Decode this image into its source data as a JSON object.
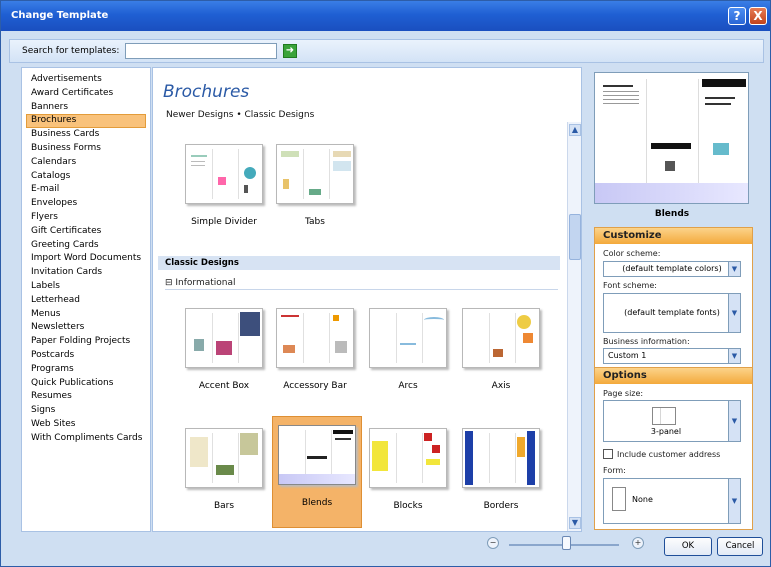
{
  "window": {
    "title": "Change Template",
    "help_label": "?",
    "close_label": "X"
  },
  "search": {
    "label": "Search for templates:",
    "value": "",
    "placeholder": ""
  },
  "categories": [
    "Advertisements",
    "Award Certificates",
    "Banners",
    "Brochures",
    "Business Cards",
    "Business Forms",
    "Calendars",
    "Catalogs",
    "E-mail",
    "Envelopes",
    "Flyers",
    "Gift Certificates",
    "Greeting Cards",
    "Import Word Documents",
    "Invitation Cards",
    "Labels",
    "Letterhead",
    "Menus",
    "Newsletters",
    "Paper Folding Projects",
    "Postcards",
    "Programs",
    "Quick Publications",
    "Resumes",
    "Signs",
    "Web Sites",
    "With Compliments Cards"
  ],
  "selected_category": "Brochures",
  "main": {
    "heading": "Brochures",
    "subnav": "Newer Designs • Classic Designs",
    "newer_templates": [
      {
        "label": "Simple Divider"
      },
      {
        "label": "Tabs"
      }
    ],
    "section_title": "Classic Designs",
    "subsection": "⊟ Informational",
    "classic_templates": [
      {
        "label": "Accent Box"
      },
      {
        "label": "Accessory Bar"
      },
      {
        "label": "Arcs"
      },
      {
        "label": "Axis"
      },
      {
        "label": "Bars"
      },
      {
        "label": "Blends",
        "selected": true
      },
      {
        "label": "Blocks"
      },
      {
        "label": "Borders"
      }
    ]
  },
  "preview": {
    "name": "Blends"
  },
  "customize": {
    "title": "Customize",
    "color_label": "Color scheme:",
    "color_value": "(default template colors)",
    "font_label": "Font scheme:",
    "font_value": "(default template fonts)",
    "business_label": "Business information:",
    "business_value": "Custom 1"
  },
  "options": {
    "title": "Options",
    "page_size_label": "Page size:",
    "page_size_value": "3-panel",
    "include_address_label": "Include customer address",
    "include_address_checked": false,
    "form_label": "Form:",
    "form_value": "None"
  },
  "buttons": {
    "ok": "OK",
    "cancel": "Cancel"
  },
  "colors": {
    "accent": "#f4b368",
    "title_blue": "#2b5aa6",
    "titlebar": "#1f5fd3"
  }
}
